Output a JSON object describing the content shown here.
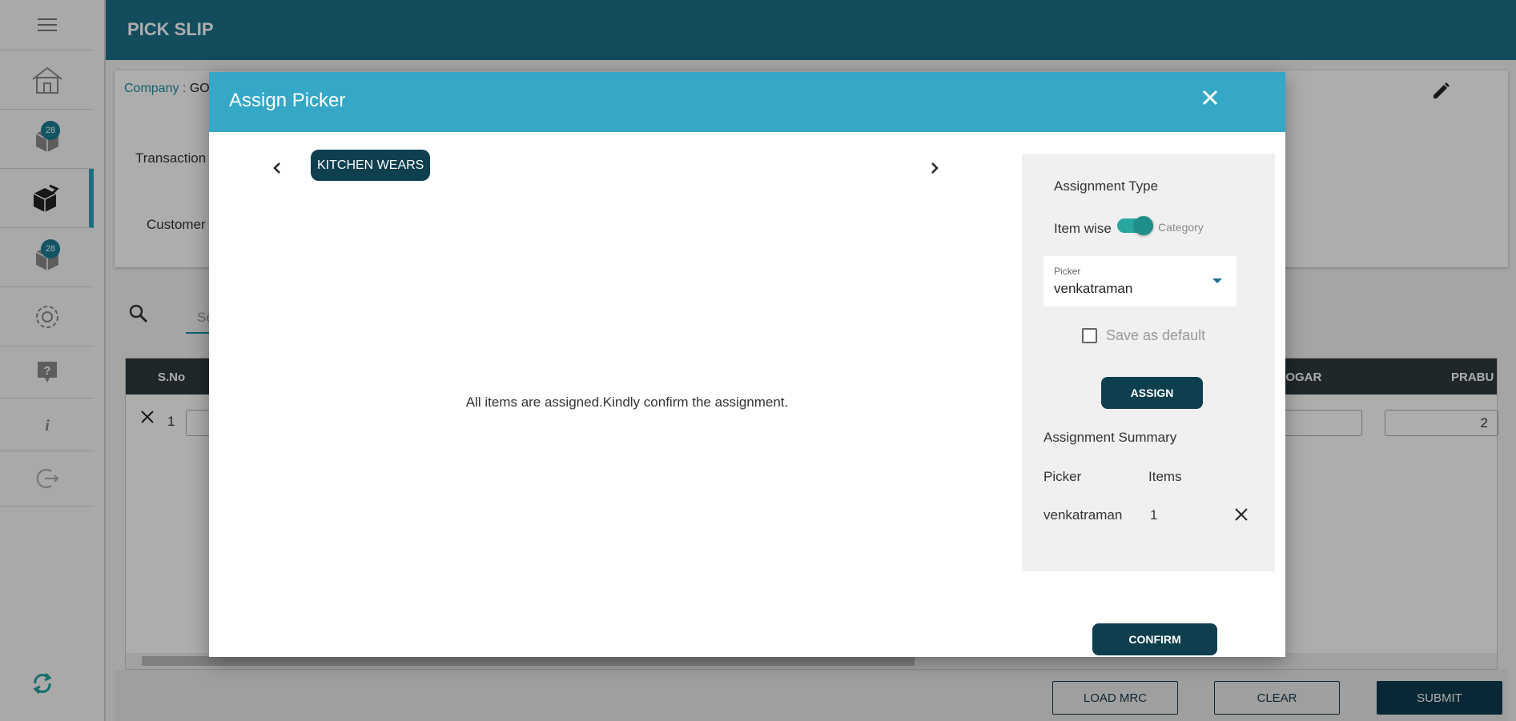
{
  "header": {
    "title": "PICK SLIP"
  },
  "sidebar": {
    "badges": [
      "28",
      "28"
    ],
    "items": [
      {
        "icon": "menu-icon"
      },
      {
        "icon": "home-icon"
      },
      {
        "icon": "package-icon",
        "badge": "28"
      },
      {
        "icon": "open-box-icon"
      },
      {
        "icon": "package-icon",
        "badge": "28"
      },
      {
        "icon": "gear-icon"
      },
      {
        "icon": "help-icon"
      },
      {
        "icon": "info-icon"
      },
      {
        "icon": "logout-icon"
      },
      {
        "icon": "sync-icon"
      }
    ]
  },
  "background": {
    "company_label": "Company : ",
    "company_value": "GO",
    "transaction_label": "Transaction",
    "customer_label": "Customer",
    "search_placeholder": "Se",
    "grid": {
      "columns": [
        "S.No",
        "JOGAR",
        "PRABU"
      ],
      "row_no": "1",
      "prabu_value": "2"
    },
    "buttons": {
      "load_mrc": "LOAD MRC",
      "clear": "CLEAR",
      "submit": "SUBMIT"
    }
  },
  "modal": {
    "title": "Assign Picker",
    "category_chip": "KITCHEN WEARS",
    "empty_message": "All items are assigned.Kindly confirm the assignment.",
    "panel": {
      "assignment_type_label": "Assignment Type",
      "toggle_left": "Item wise",
      "toggle_right": "Category",
      "picker_label": "Picker",
      "picker_value": "venkatraman",
      "save_default_label": "Save as default",
      "assign_label": "ASSIGN",
      "summary_title": "Assignment Summary",
      "summary_headers": {
        "picker": "Picker",
        "items": "Items"
      },
      "summary_rows": [
        {
          "picker": "venkatraman",
          "items": "1"
        }
      ]
    },
    "confirm_label": "CONFIRM"
  },
  "colors": {
    "header_bg": "#1b7189",
    "modal_header_bg": "#34a8c6",
    "primary_dark": "#0e3f4f",
    "toggle_on": "#2aa6a0"
  }
}
